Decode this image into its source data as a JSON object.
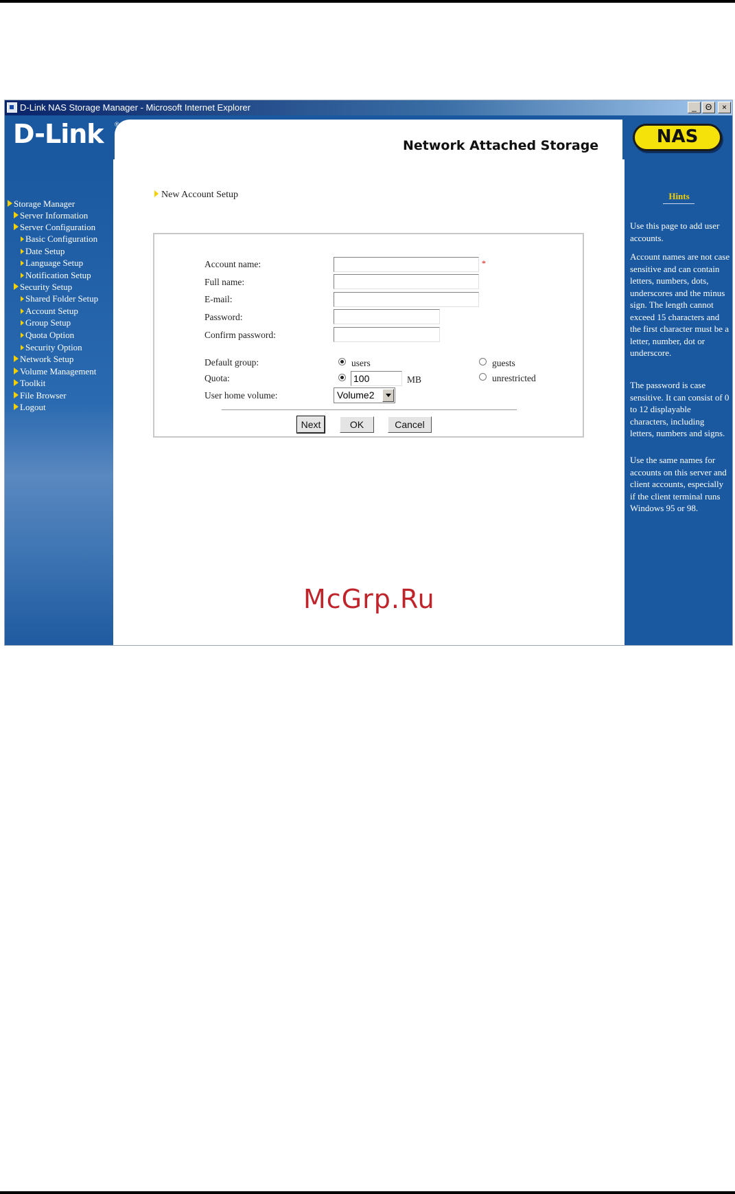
{
  "window": {
    "title": "D-Link NAS Storage Manager - Microsoft Internet Explorer",
    "controls": [
      "_",
      "Θ",
      "×"
    ]
  },
  "banner": {
    "logo": "D-Link",
    "logo_mark": "®",
    "subtitle": "Network Attached Storage",
    "badge": "NAS"
  },
  "nav": {
    "items": [
      {
        "label": "Storage Manager",
        "level": 0
      },
      {
        "label": "Server Information",
        "level": 1
      },
      {
        "label": "Server Configuration",
        "level": 1
      },
      {
        "label": "Basic Configuration",
        "level": 2
      },
      {
        "label": "Date Setup",
        "level": 2
      },
      {
        "label": "Language Setup",
        "level": 2
      },
      {
        "label": "Notification Setup",
        "level": 2
      },
      {
        "label": "Security Setup",
        "level": 1
      },
      {
        "label": "Shared Folder Setup",
        "level": 2
      },
      {
        "label": "Account Setup",
        "level": 2
      },
      {
        "label": "Group Setup",
        "level": 2
      },
      {
        "label": "Quota Option",
        "level": 2
      },
      {
        "label": "Security Option",
        "level": 2
      },
      {
        "label": "Network Setup",
        "level": 1
      },
      {
        "label": "Volume Management",
        "level": 1
      },
      {
        "label": "Toolkit",
        "level": 1
      },
      {
        "label": "File Browser",
        "level": 1
      },
      {
        "label": "Logout",
        "level": 1
      }
    ]
  },
  "page": {
    "section_title": "New Account Setup"
  },
  "form": {
    "account_name_label": "Account name:",
    "account_name_value": "",
    "required_mark": "*",
    "full_name_label": "Full name:",
    "full_name_value": "",
    "email_label": "E-mail:",
    "email_value": "",
    "password_label": "Password:",
    "password_value": "",
    "confirm_password_label": "Confirm password:",
    "confirm_password_value": "",
    "default_group_label": "Default group:",
    "group_options": [
      "users",
      "guests"
    ],
    "group_selected": "users",
    "quota_label": "Quota:",
    "quota_value": "100",
    "quota_unit": "MB",
    "quota_unrestricted_label": "unrestricted",
    "quota_selected": "limited",
    "home_volume_label": "User home volume:",
    "home_volume_value": "Volume2",
    "buttons": {
      "next": "Next",
      "ok": "OK",
      "cancel": "Cancel"
    }
  },
  "hints": {
    "title": "Hints",
    "paragraphs": [
      "Use this page to add user accounts.",
      "Account names are not case sensitive and can contain letters, numbers, dots, underscores and the minus sign. The length cannot exceed 15 characters and the first character must be a letter, number, dot or underscore.",
      "The password is case sensitive. It can consist of 0 to 12 displayable characters, including letters, numbers and signs.",
      "Use the same names for accounts on this server and client accounts, especially if the client terminal runs Windows 95 or 98."
    ]
  },
  "watermark": "McGrp.Ru"
}
